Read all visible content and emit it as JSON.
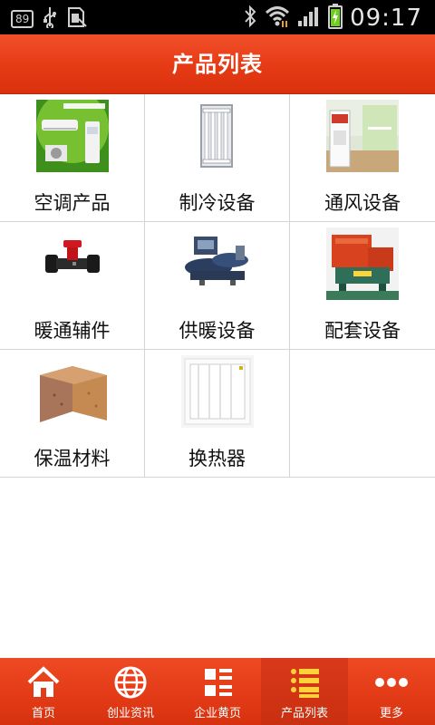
{
  "status_bar": {
    "battery_level_text": "89",
    "time": "09:17"
  },
  "header": {
    "title": "产品列表"
  },
  "products": [
    {
      "label": "空调产品",
      "image": "air-conditioner-image"
    },
    {
      "label": "制冷设备",
      "image": "radiator-panel-image"
    },
    {
      "label": "通风设备",
      "image": "ventilation-cabinet-image"
    },
    {
      "label": "暖通辅件",
      "image": "valve-fitting-image"
    },
    {
      "label": "供暖设备",
      "image": "chiller-unit-image"
    },
    {
      "label": "配套设备",
      "image": "boiler-unit-image"
    },
    {
      "label": "保温材料",
      "image": "insulation-bricks-image"
    },
    {
      "label": "换热器",
      "image": "heat-exchanger-image"
    }
  ],
  "tabbar": {
    "tabs": [
      {
        "label": "首页",
        "icon": "home-icon"
      },
      {
        "label": "创业资讯",
        "icon": "globe-icon"
      },
      {
        "label": "企业黄页",
        "icon": "grid-list-icon"
      },
      {
        "label": "产品列表",
        "icon": "list-icon",
        "active": true
      },
      {
        "label": "更多",
        "icon": "more-dots-icon"
      }
    ]
  },
  "colors": {
    "accent": "#e63a14",
    "divider": "#d4d4d4"
  }
}
